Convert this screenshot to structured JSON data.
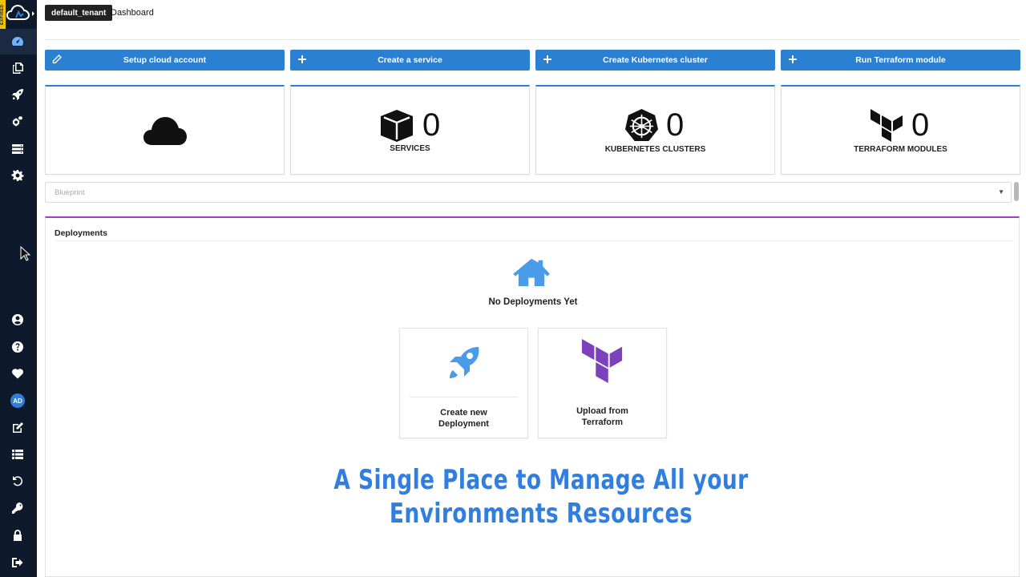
{
  "app": {
    "tenant": "default_tenant",
    "page_title": "Dashboard",
    "expired_badge": "EXPIRED",
    "accent_color": "#2c80d2",
    "sidebar_bg": "#0e1a2b"
  },
  "sidebar": {
    "top_icons": [
      "dashboard-icon",
      "copy-icon",
      "rocket-icon",
      "cogs-icon",
      "server-icon",
      "settings-icon"
    ],
    "bottom_icons": [
      "user-icon",
      "help-icon",
      "heartbeat-icon",
      "avatar",
      "edit-icon",
      "list-icon",
      "undo-icon",
      "key-icon",
      "lock-icon",
      "logout-icon"
    ],
    "avatar_initials": "AD"
  },
  "actions": [
    {
      "label": "Setup cloud account",
      "icon": "pencil-icon"
    },
    {
      "label": "Create a service",
      "icon": "plus-icon"
    },
    {
      "label": "Create Kubernetes cluster",
      "icon": "plus-icon"
    },
    {
      "label": "Run Terraform module",
      "icon": "plus-icon"
    }
  ],
  "cards": [
    {
      "icon": "cloud-icon"
    },
    {
      "icon": "cube-icon",
      "count": "0",
      "label": "SERVICES"
    },
    {
      "icon": "kubernetes-icon",
      "count": "0",
      "label": "KUBERNETES CLUSTERS"
    },
    {
      "icon": "terraform-icon",
      "count": "0",
      "label": "TERRAFORM MODULES"
    }
  ],
  "blueprint": {
    "placeholder": "Blueprint"
  },
  "deployments": {
    "title": "Deployments",
    "empty_text": "No Deployments Yet",
    "options": [
      {
        "label_line1": "Create new",
        "label_line2": "Deployment",
        "icon": "rocket-icon"
      },
      {
        "label_line1": "Upload from",
        "label_line2": "Terraform",
        "icon": "terraform-icon"
      }
    ]
  },
  "headline": {
    "line1": "A Single Place to Manage All your",
    "line2": "Environments Resources"
  }
}
